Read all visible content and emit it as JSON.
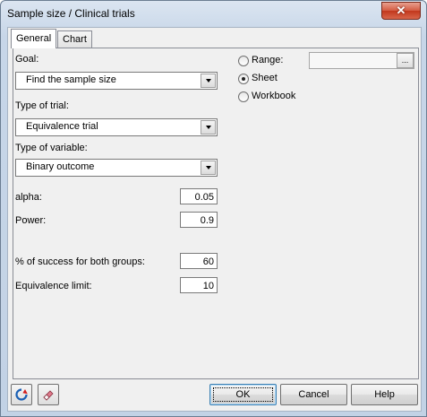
{
  "window": {
    "title": "Sample size / Clinical trials"
  },
  "tabs": [
    {
      "label": "General",
      "active": true
    },
    {
      "label": "Chart",
      "active": false
    }
  ],
  "goal": {
    "label": "Goal:",
    "value": "Find the sample size"
  },
  "trial_type": {
    "label": "Type of trial:",
    "value": "Equivalence trial"
  },
  "variable_type": {
    "label": "Type of variable:",
    "value": "Binary outcome"
  },
  "alpha": {
    "label": "alpha:",
    "value": "0.05"
  },
  "power": {
    "label": "Power:",
    "value": "0.9"
  },
  "success": {
    "label": "% of success for both groups:",
    "value": "60"
  },
  "equivalence": {
    "label": "Equivalence limit:",
    "value": "10"
  },
  "output": {
    "range_label": "Range:",
    "range_value": "",
    "range_button": "...",
    "sheet_label": "Sheet",
    "workbook_label": "Workbook",
    "selected": "Sheet"
  },
  "buttons": {
    "ok": "OK",
    "cancel": "Cancel",
    "help": "Help"
  },
  "colors": {
    "close_button": "#c2371c",
    "default_button_border": "#3c7fb1"
  }
}
